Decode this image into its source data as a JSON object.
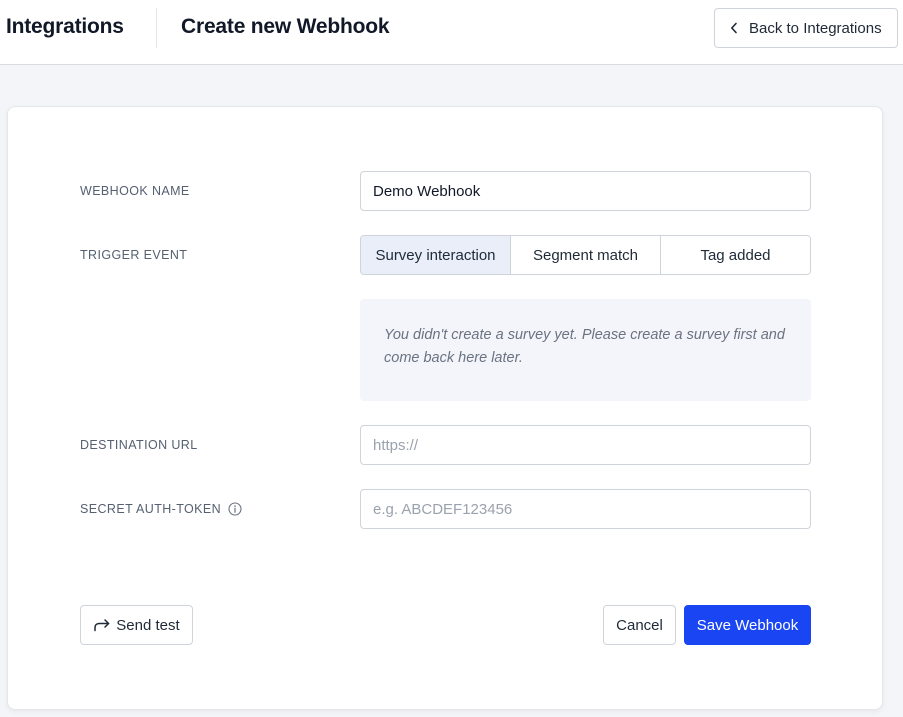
{
  "header": {
    "app_title": "Integrations",
    "page_title": "Create new Webhook",
    "back_label": "Back to Integrations"
  },
  "form": {
    "webhook_name": {
      "label": "WEBHOOK NAME",
      "value": "Demo Webhook"
    },
    "trigger_event": {
      "label": "TRIGGER EVENT",
      "options": [
        "Survey interaction",
        "Segment match",
        "Tag added"
      ],
      "selected": "Survey interaction"
    },
    "notice": "You didn't create a survey yet. Please create a survey first and come back here later.",
    "destination_url": {
      "label": "DESTINATION URL",
      "placeholder": "https://"
    },
    "secret_token": {
      "label": "SECRET AUTH-TOKEN",
      "placeholder": "e.g. ABCDEF123456"
    }
  },
  "actions": {
    "send_test": "Send test",
    "cancel": "Cancel",
    "save": "Save Webhook"
  },
  "colors": {
    "primary": "#1a45f2",
    "selected_segment_bg": "#e9eef8",
    "notice_bg": "#f3f5fa"
  }
}
